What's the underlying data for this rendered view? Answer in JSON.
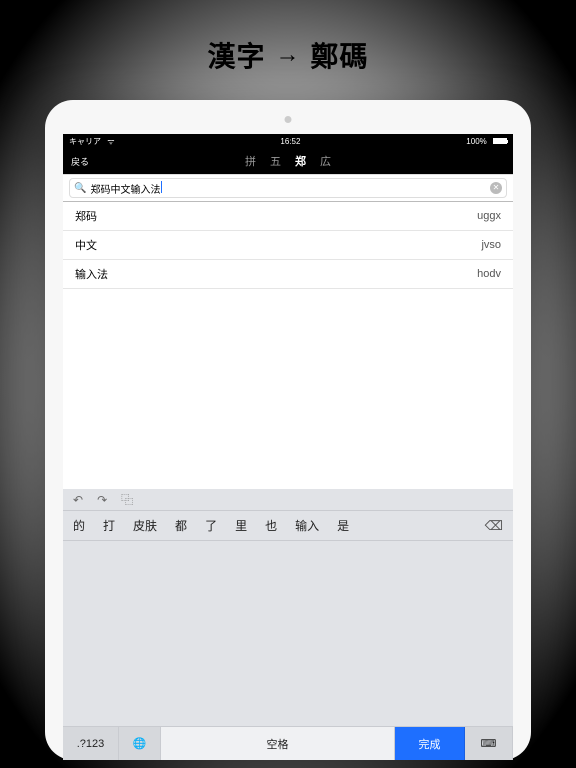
{
  "promo": {
    "left": "漢字",
    "arrow": "→",
    "right": "鄭碼"
  },
  "statusbar": {
    "carrier": "キャリア",
    "time": "16:52",
    "battery": "100%"
  },
  "nav": {
    "back": "戻る",
    "tabs": [
      "拼",
      "五",
      "郑",
      "広"
    ],
    "active_index": 2
  },
  "search": {
    "value": "郑码中文输入法"
  },
  "results": [
    {
      "word": "郑码",
      "code": "uggx"
    },
    {
      "word": "中文",
      "code": "jvso"
    },
    {
      "word": "输入法",
      "code": "hodv"
    }
  ],
  "keyboard": {
    "tool_undo": "↶",
    "tool_redo": "↷",
    "tool_paste": "⿻",
    "candidates": [
      "的",
      "打",
      "皮肤",
      "都",
      "了",
      "里",
      "也",
      "输入",
      "是"
    ],
    "delete": "⌫",
    "mode_key": ".?123",
    "globe": "🌐",
    "space": "空格",
    "done": "完成",
    "hide": "⌨"
  }
}
